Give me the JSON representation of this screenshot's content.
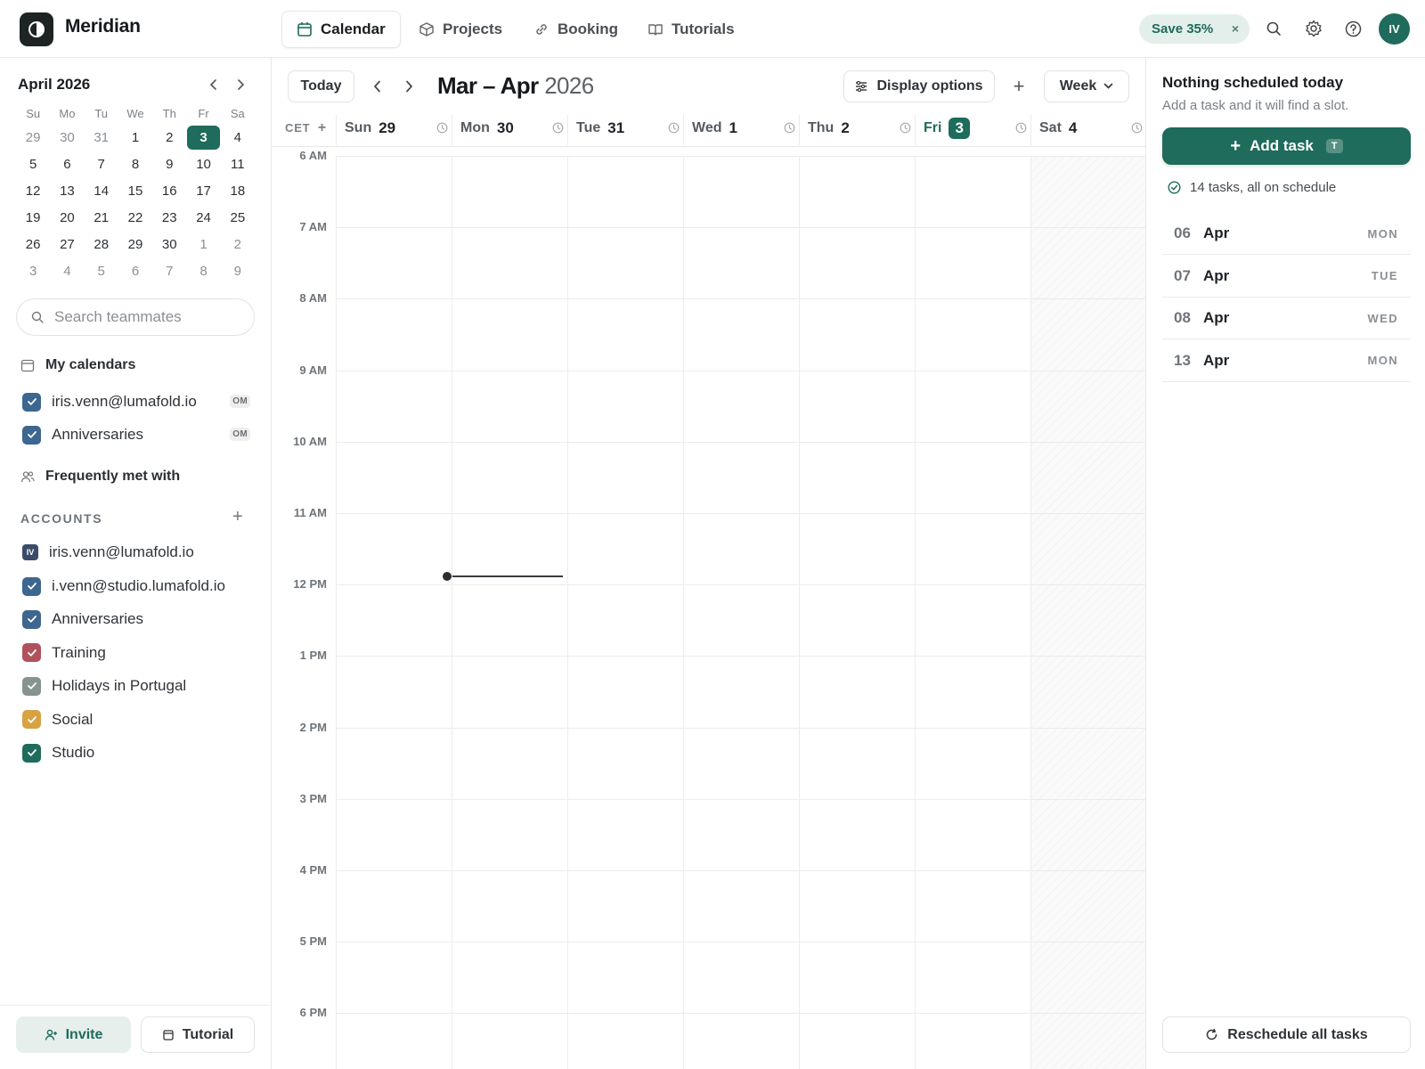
{
  "app": {
    "name": "Meridian"
  },
  "nav": {
    "tabs": [
      {
        "label": "Calendar",
        "icon": "calendar-icon",
        "active": true
      },
      {
        "label": "Projects",
        "icon": "cube-icon",
        "active": false
      },
      {
        "label": "Booking",
        "icon": "link-icon",
        "active": false
      },
      {
        "label": "Tutorials",
        "icon": "book-icon",
        "active": false
      }
    ],
    "promo": {
      "label": "Save 35%",
      "close": "×"
    },
    "avatar_initials": "IV"
  },
  "mini_calendar": {
    "title": "April 2026",
    "weekdays": [
      "Su",
      "Mo",
      "Tu",
      "We",
      "Th",
      "Fr",
      "Sa"
    ],
    "weeks": [
      [
        "29",
        "30",
        "31",
        "1",
        "2",
        "3",
        "4"
      ],
      [
        "5",
        "6",
        "7",
        "8",
        "9",
        "10",
        "11"
      ],
      [
        "12",
        "13",
        "14",
        "15",
        "16",
        "17",
        "18"
      ],
      [
        "19",
        "20",
        "21",
        "22",
        "23",
        "24",
        "25"
      ],
      [
        "26",
        "27",
        "28",
        "29",
        "30",
        "1",
        "2"
      ],
      [
        "3",
        "4",
        "5",
        "6",
        "7",
        "8",
        "9"
      ]
    ],
    "today": "3"
  },
  "sidebar": {
    "search_placeholder": "Search teammates",
    "my_calendars": {
      "label": "My calendars",
      "items": [
        {
          "label": "iris.venn@lumafold.io",
          "color": "#3d6690",
          "tag": "OM"
        },
        {
          "label": "Anniversaries",
          "color": "#3d6690",
          "tag": "OM"
        }
      ]
    },
    "frequently_met": "Frequently met with",
    "accounts": {
      "label": "ACCOUNTS",
      "owner": {
        "badge": "IV",
        "label": "iris.venn@lumafold.io"
      },
      "items": [
        {
          "label": "i.venn@studio.lumafold.io",
          "color": "#3d6690"
        },
        {
          "label": "Anniversaries",
          "color": "#3d6690"
        },
        {
          "label": "Training",
          "color": "#b0525e"
        },
        {
          "label": "Holidays in Portugal",
          "color": "#86938e"
        },
        {
          "label": "Social",
          "color": "#d6a243"
        },
        {
          "label": "Studio",
          "color": "#1f6b5c"
        }
      ]
    },
    "invite_label": "Invite",
    "tutorial_label": "Tutorial"
  },
  "toolbar": {
    "today_label": "Today",
    "range_title": "Mar – Apr",
    "range_year": "2026",
    "display_options_label": "Display options",
    "view_label": "Week"
  },
  "week": {
    "timezone": "CET",
    "days": [
      {
        "name": "Sun",
        "date": "29",
        "today": false
      },
      {
        "name": "Mon",
        "date": "30",
        "today": false
      },
      {
        "name": "Tue",
        "date": "31",
        "today": false
      },
      {
        "name": "Wed",
        "date": "1",
        "today": false
      },
      {
        "name": "Thu",
        "date": "2",
        "today": false
      },
      {
        "name": "Fri",
        "date": "3",
        "today": true
      },
      {
        "name": "Sat",
        "date": "4",
        "today": false
      }
    ],
    "hours": [
      "6 AM",
      "7 AM",
      "8 AM",
      "9 AM",
      "10 AM",
      "11 AM",
      "12 PM",
      "1 PM",
      "2 PM",
      "3 PM",
      "4 PM",
      "5 PM",
      "6 PM"
    ]
  },
  "tasks_panel": {
    "title": "Nothing scheduled today",
    "subtitle": "Add a task and it will find a slot.",
    "add_task_label": "Add task",
    "add_task_shortcut": "T",
    "status": "14 tasks, all on schedule",
    "days": [
      {
        "num": "06",
        "month": "Apr",
        "weekday": "MON"
      },
      {
        "num": "07",
        "month": "Apr",
        "weekday": "TUE"
      },
      {
        "num": "08",
        "month": "Apr",
        "weekday": "WED"
      },
      {
        "num": "13",
        "month": "Apr",
        "weekday": "MON"
      }
    ],
    "reschedule_label": "Reschedule all tasks"
  },
  "colors": {
    "accent": "#1f6b5c",
    "promo_bg": "#e4efeb"
  }
}
